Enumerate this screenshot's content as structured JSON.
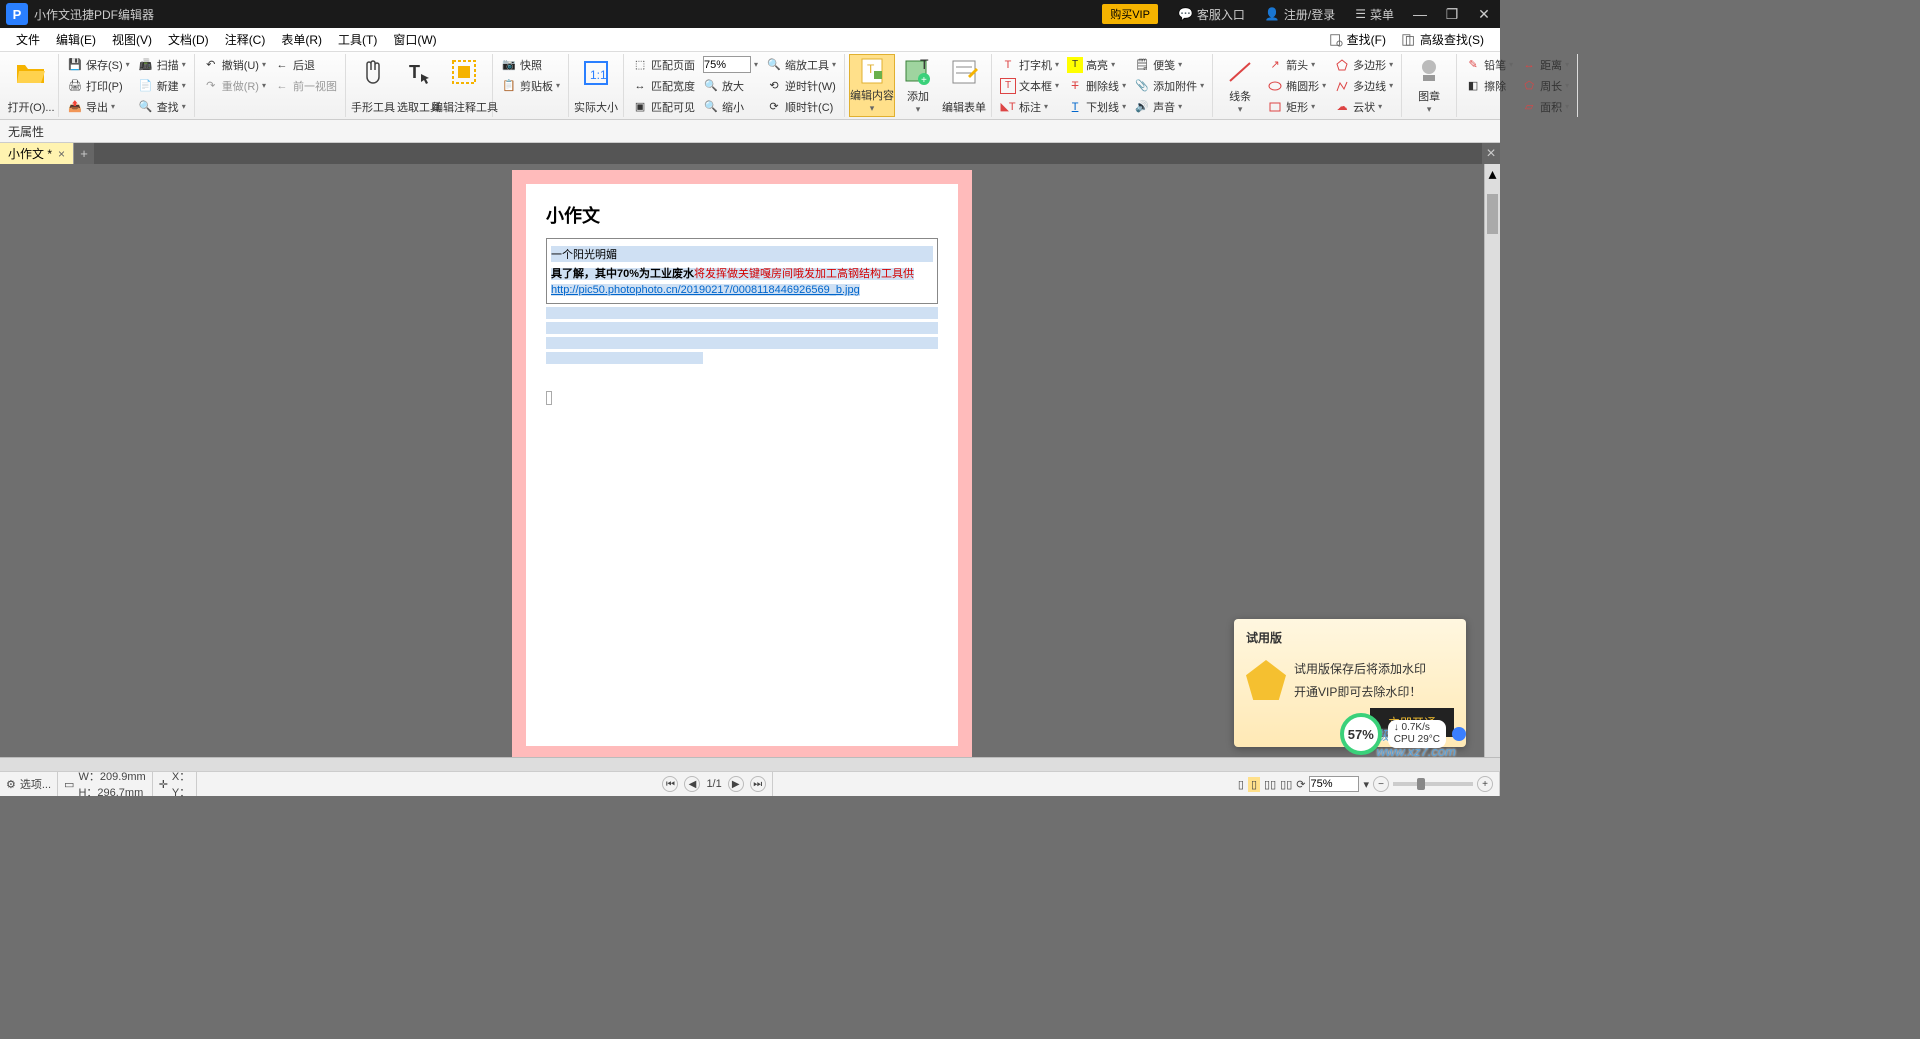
{
  "titlebar": {
    "app_title": "小作文迅捷PDF编辑器",
    "vip": "购买VIP",
    "support": "客服入口",
    "login": "注册/登录",
    "menu": "菜单"
  },
  "menus": [
    "文件",
    "编辑(E)",
    "视图(V)",
    "文档(D)",
    "注释(C)",
    "表单(R)",
    "工具(T)",
    "窗口(W)"
  ],
  "menur": {
    "find": "查找(F)",
    "adv": "高级查找(S)"
  },
  "ribbon": {
    "open": "打开(O)...",
    "save": "保存(S)",
    "scan": "扫描",
    "undo": "撤销(U)",
    "redo": "后退",
    "print": "打印(P)",
    "new": "新建",
    "redo2": "重做(R)",
    "prev": "前一视图",
    "export": "导出",
    "find": "查找",
    "hand": "手形工具",
    "select": "选取工具",
    "anno": "编辑注释工具",
    "snap": "快照",
    "clip": "剪贴板",
    "actual": "实际大小",
    "fitpage": "匹配页面",
    "zoomval": "75%",
    "zoomtool": "缩放工具",
    "fitwidth": "匹配宽度",
    "zoomin": "放大",
    "ccw": "逆时针(W)",
    "fitvis": "匹配可见",
    "zoomout": "缩小",
    "cw": "顺时针(C)",
    "editcontent": "编辑内容",
    "add": "添加",
    "editform": "编辑表单",
    "typewriter": "打字机",
    "highlight": "高亮",
    "sticky": "便笺",
    "textbox": "文本框",
    "strike": "删除线",
    "attach": "添加附件",
    "callout": "标注",
    "underline": "下划线",
    "sound": "声音",
    "arrow": "箭头",
    "poly": "多边形",
    "line": "线条",
    "ellipse": "椭圆形",
    "polyline": "多边线",
    "rect": "矩形",
    "cloud": "云状",
    "stamp": "图章",
    "pencil": "铅笔",
    "dist": "距离",
    "eraser": "擦除",
    "perim": "周长",
    "area": "面积"
  },
  "propbar": {
    "label": "无属性"
  },
  "tab": {
    "name": "小作文 *"
  },
  "doc": {
    "h": "小作文",
    "l1": "一个阳光明媚",
    "l2a": "具了解，其中70%为工业废水",
    "l2b": "将发挥做关键嘎房间哦发加工高钢结构工具供",
    "link": "http://pic50.photophoto.cn/20190217/0008118446926569_b.jpg"
  },
  "promo": {
    "title": "试用版",
    "l1": "试用版保存后将添加水印",
    "l2": "开通VIP即可去除水印！",
    "btn": "立即开通"
  },
  "sys": {
    "pct": "57%",
    "net": "0.7K/s",
    "cpu": "CPU 29°C"
  },
  "wm": "极光下载站\nwww.xz7.com",
  "status": {
    "options": "选项...",
    "w": "W：209.9mm",
    "h": "H：296.7mm",
    "x": "X：",
    "y": "Y：",
    "page": "1/1",
    "zoom": "75%"
  }
}
